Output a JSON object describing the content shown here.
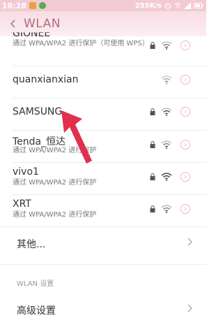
{
  "status_bar": {
    "time": "18:28",
    "speed": "255K/s",
    "colors": {
      "bg": "#f3c9d4"
    }
  },
  "header": {
    "title": "WLAN",
    "back_icon": "chevron-left-icon"
  },
  "networks": [
    {
      "name": "GIONEE",
      "subtitle": "通过 WPA/WPA2 进行保护（可使用 WPS）",
      "secured": true,
      "signal": "medium"
    },
    {
      "name": "quanxianxian",
      "subtitle": "",
      "secured": false,
      "signal": "medium"
    },
    {
      "name": "SAMSUNG",
      "subtitle": "",
      "secured": true,
      "signal": "strong"
    },
    {
      "name": "Tenda_恒达",
      "subtitle": "通过 WPA/WPA2 进行保护",
      "secured": true,
      "signal": "medium"
    },
    {
      "name": "vivo1",
      "subtitle": "通过 WPA/WPA2 进行保护",
      "secured": true,
      "signal": "strong"
    },
    {
      "name": "XRT",
      "subtitle": "通过 WPA/WPA2 进行保护",
      "secured": true,
      "signal": "medium"
    }
  ],
  "more": {
    "label": "其他..."
  },
  "section": {
    "label": "WLAN 设置"
  },
  "advanced": {
    "label": "高级设置"
  },
  "colors": {
    "accent": "#b56b7f",
    "pointer": "#e0304e",
    "divider": "#ececec"
  }
}
